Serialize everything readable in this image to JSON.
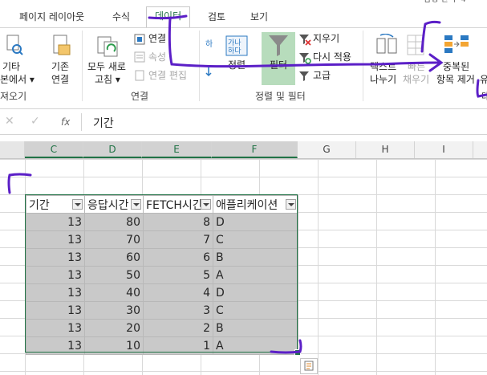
{
  "top_cut_text": "탐정 만 수 4",
  "tabs": [
    {
      "label": "페이지 레이아웃",
      "active": false
    },
    {
      "label": "수식",
      "active": false
    },
    {
      "label": "데이터",
      "active": true
    },
    {
      "label": "검토",
      "active": false
    },
    {
      "label": "보기",
      "active": false
    }
  ],
  "ribbon": {
    "get_external": {
      "line1": "기타",
      "line2": "본에서 ▾"
    },
    "existing_conn": {
      "line1": "기존",
      "line2": "연결"
    },
    "refresh_all": {
      "line1": "모두 새로",
      "line2": "고침 ▾"
    },
    "connections": "연결",
    "properties": "속성",
    "edit_links": "연결 편집",
    "sort": "정렬",
    "filter": "필터",
    "clear": "지우기",
    "reapply": "다시 적용",
    "advanced": "고급",
    "text_to_columns": {
      "line1": "텍스트",
      "line2": "나누기"
    },
    "flash_fill": {
      "line1": "빠른",
      "line2": "채우기"
    },
    "remove_dup": {
      "line1": "중복된",
      "line2": "항목 제거"
    },
    "more": "유",
    "groups": {
      "ext": "져오기",
      "conn": "연결",
      "sortfilter": "정렬 및 필터",
      "tools": "데"
    }
  },
  "formula_bar": {
    "cancel": "✕",
    "enter": "✓",
    "fx": "fx",
    "value": "기간"
  },
  "columns": [
    {
      "label": "C",
      "selected": true
    },
    {
      "label": "D",
      "selected": true
    },
    {
      "label": "E",
      "selected": true
    },
    {
      "label": "F",
      "selected": true
    },
    {
      "label": "G",
      "selected": false
    },
    {
      "label": "H",
      "selected": false
    },
    {
      "label": "I",
      "selected": false
    }
  ],
  "table": {
    "headers": [
      "기간",
      "응답시간",
      "FETCH시간",
      "애플리케이션"
    ],
    "rows": [
      [
        "13",
        "80",
        "8",
        "D"
      ],
      [
        "13",
        "70",
        "7",
        "C"
      ],
      [
        "13",
        "60",
        "6",
        "B"
      ],
      [
        "13",
        "50",
        "5",
        "A"
      ],
      [
        "13",
        "40",
        "4",
        "D"
      ],
      [
        "13",
        "30",
        "3",
        "C"
      ],
      [
        "13",
        "20",
        "2",
        "B"
      ],
      [
        "13",
        "10",
        "1",
        "A"
      ]
    ]
  },
  "colors": {
    "accent": "#217346",
    "annotation": "#5b1fc7",
    "selection_fill": "#c9c9c9"
  }
}
